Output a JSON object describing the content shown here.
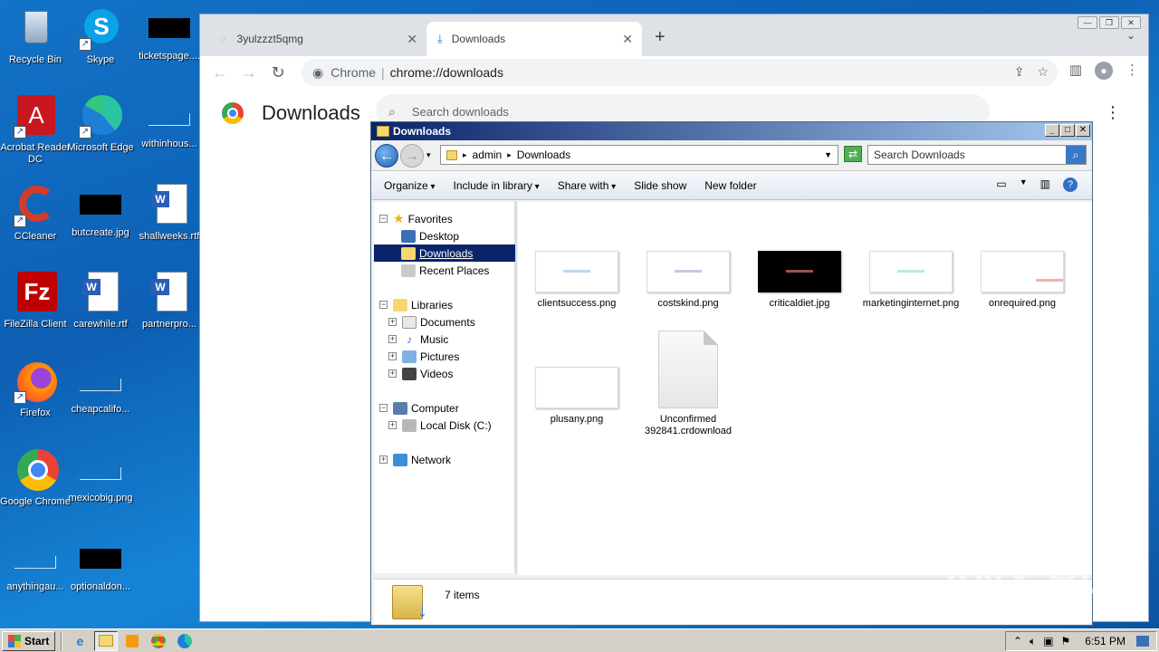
{
  "desktop": {
    "icons": [
      {
        "label": "Recycle Bin",
        "icon": "recycle-bin-icon"
      },
      {
        "label": "Skype",
        "icon": "skype-icon"
      },
      {
        "label": "ticketspage....",
        "icon": "black-file-icon"
      },
      {
        "label": "Acrobat Reader DC",
        "icon": "acrobat-icon"
      },
      {
        "label": "Microsoft Edge",
        "icon": "edge-icon"
      },
      {
        "label": "withinhous...",
        "icon": "blank-file-icon"
      },
      {
        "label": "CCleaner",
        "icon": "ccleaner-icon"
      },
      {
        "label": "butcreate.jpg",
        "icon": "black-file-icon"
      },
      {
        "label": "shallweeks.rtf",
        "icon": "word-doc-icon"
      },
      {
        "label": "FileZilla Client",
        "icon": "filezilla-icon"
      },
      {
        "label": "carewhile.rtf",
        "icon": "word-doc-icon"
      },
      {
        "label": "partnerpro...",
        "icon": "word-doc-icon"
      },
      {
        "label": "Firefox",
        "icon": "firefox-icon"
      },
      {
        "label": "cheapcalifo...",
        "icon": "blank-file-icon"
      },
      {
        "label": "Google Chrome",
        "icon": "chrome-icon"
      },
      {
        "label": "mexicobig.png",
        "icon": "blank-file-icon"
      },
      {
        "label": "anythingau...",
        "icon": "blank-file-icon"
      },
      {
        "label": "optionaldon...",
        "icon": "black-file-icon"
      }
    ]
  },
  "chrome": {
    "tabs": [
      {
        "label": "3yulzzzt5qmg",
        "icon": "loading-icon"
      },
      {
        "label": "Downloads",
        "icon": "download-icon"
      }
    ],
    "new_tab": "+",
    "omnibox": {
      "site": "Chrome",
      "separator": "|",
      "url": "chrome://downloads"
    },
    "page_title": "Downloads",
    "search_placeholder": "Search downloads"
  },
  "explorer": {
    "title": "Downloads",
    "breadcrumb": [
      "admin",
      "Downloads"
    ],
    "search_placeholder": "Search Downloads",
    "commands": [
      "Organize",
      "Include in library",
      "Share with",
      "Slide show",
      "New folder"
    ],
    "nav": {
      "favorites": "Favorites",
      "favorites_items": [
        "Desktop",
        "Downloads",
        "Recent Places"
      ],
      "libraries": "Libraries",
      "libraries_items": [
        "Documents",
        "Music",
        "Pictures",
        "Videos"
      ],
      "computer": "Computer",
      "computer_items": [
        "Local Disk (C:)"
      ],
      "network": "Network"
    },
    "files": [
      {
        "name": "clientsuccess.png",
        "thumb": "white",
        "accent": "#bcd8f0"
      },
      {
        "name": "costskind.png",
        "thumb": "white",
        "accent": "#c8c8e0"
      },
      {
        "name": "criticaldiet.jpg",
        "thumb": "black",
        "accent": "#a05050"
      },
      {
        "name": "marketinginternet.png",
        "thumb": "white",
        "accent": "#b8e8e8"
      },
      {
        "name": "onrequired.png",
        "thumb": "white",
        "accent": "#f0b0b0"
      },
      {
        "name": "plusany.png",
        "thumb": "white",
        "accent": "#ffffff"
      },
      {
        "name": "Unconfirmed 392841.crdownload",
        "thumb": "doc",
        "accent": "#e6e6e6"
      }
    ],
    "status": "7 items"
  },
  "watermark": "ANY RUN",
  "taskbar": {
    "start": "Start",
    "clock": "6:51 PM",
    "apps": [
      "ie-icon",
      "explorer-icon",
      "media-player-icon",
      "chrome-icon",
      "edge-icon"
    ]
  }
}
